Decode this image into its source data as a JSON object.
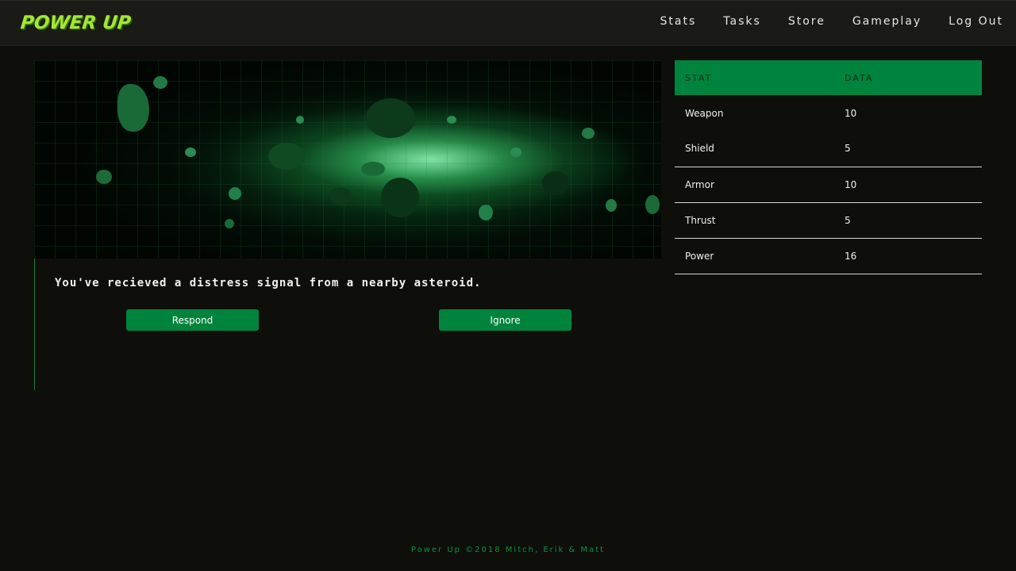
{
  "app": {
    "logo": "POWER UP",
    "brand_color": "#a5e635",
    "accent": "#00843d"
  },
  "nav": {
    "items": [
      "Stats",
      "Tasks",
      "Store",
      "Gameplay",
      "Log Out"
    ]
  },
  "hero": {
    "image": "asteroid-field-illustration"
  },
  "story": {
    "text": "You've recieved a distress signal from a nearby asteroid.",
    "respond_label": "Respond",
    "ignore_label": "Ignore"
  },
  "stats": {
    "headers": [
      "STAT",
      "DATA"
    ],
    "rows": [
      [
        "Weapon",
        "10"
      ],
      [
        "Shield",
        "5"
      ],
      [
        "Armor",
        "10"
      ],
      [
        "Thrust",
        "5"
      ],
      [
        "Power",
        "16"
      ]
    ]
  },
  "footer": {
    "text": "Power Up ©2018 Mitch, Erik & Matt"
  }
}
